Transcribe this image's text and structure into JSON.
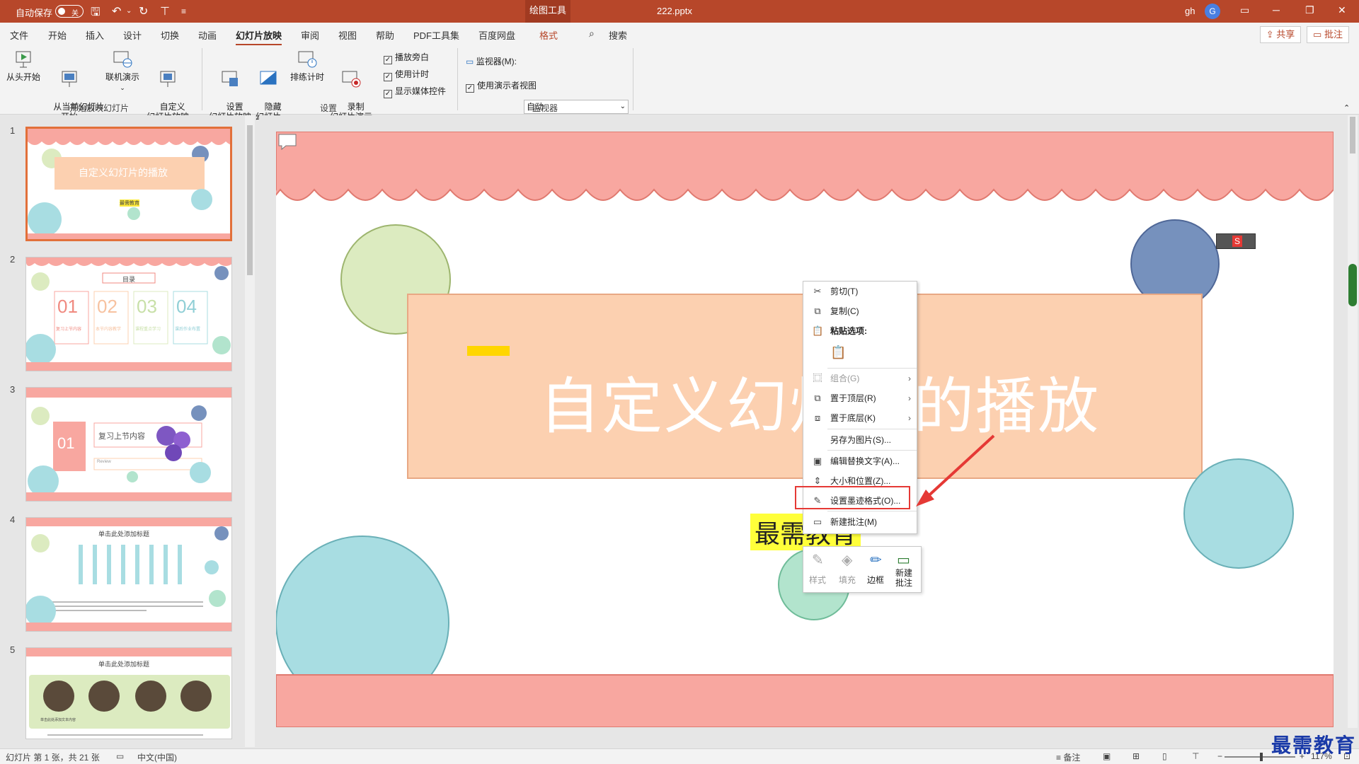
{
  "titlebar": {
    "autosave_label": "自动保存",
    "autosave_state": "关",
    "contextual_tab": "绘图工具",
    "doc_title": "222.pptx",
    "user_name": "gh",
    "user_initial": "G"
  },
  "tabs": [
    "文件",
    "开始",
    "插入",
    "设计",
    "切换",
    "动画",
    "幻灯片放映",
    "审阅",
    "视图",
    "帮助",
    "PDF工具集",
    "百度网盘",
    "格式"
  ],
  "active_tab": "幻灯片放映",
  "search_label": "搜索",
  "share_label": "共享",
  "comment_label": "批注",
  "ribbon": {
    "group1": {
      "label": "开始放映幻灯片",
      "buttons": [
        "从头开始",
        "从当前幻灯片\n开始",
        "联机演示",
        "自定义\n幻灯片放映"
      ]
    },
    "group2": {
      "label": "设置",
      "buttons": [
        "设置\n幻灯片放映",
        "隐藏\n幻灯片",
        "排练计时",
        "录制\n幻灯片演示"
      ],
      "checks": [
        "播放旁白",
        "使用计时",
        "显示媒体控件"
      ]
    },
    "group3": {
      "label": "监视器",
      "monitor_label": "监视器(M):",
      "monitor_value": "自动",
      "presenter_view": "使用演示者视图"
    }
  },
  "thumbnails": [
    {
      "num": "1",
      "title": "自定义幻灯片的播放",
      "sub": "最需教育"
    },
    {
      "num": "2",
      "title": "目录",
      "items": [
        "01",
        "02",
        "03",
        "04"
      ],
      "captions": [
        "复习上节内容",
        "本节内容教学",
        "课程重点学习",
        "课后作业布置"
      ]
    },
    {
      "num": "3",
      "badge": "01",
      "title": "复习上节内容",
      "sub": "Review"
    },
    {
      "num": "4",
      "title": "单击此处添加标题"
    },
    {
      "num": "5",
      "title": "单击此处添加标题",
      "caption": "单击此处添加文本内容"
    }
  ],
  "slide": {
    "title": "自定义幻灯片的播放",
    "subtitle": "最需教育"
  },
  "context_menu": {
    "items": [
      "剪切(T)",
      "复制(C)",
      "粘贴选项:",
      "组合(G)",
      "置于顶层(R)",
      "置于底层(K)",
      "另存为图片(S)...",
      "编辑替换文字(A)...",
      "大小和位置(Z)...",
      "设置墨迹格式(O)...",
      "新建批注(M)"
    ]
  },
  "mini_toolbar": [
    "样式",
    "填充",
    "边框",
    "新建\n批注"
  ],
  "statusbar": {
    "slide_info": "幻灯片 第 1 张，共 21 张",
    "language": "中文(中国)",
    "notes": "备注",
    "zoom": "117%"
  },
  "watermark": "最需教育"
}
